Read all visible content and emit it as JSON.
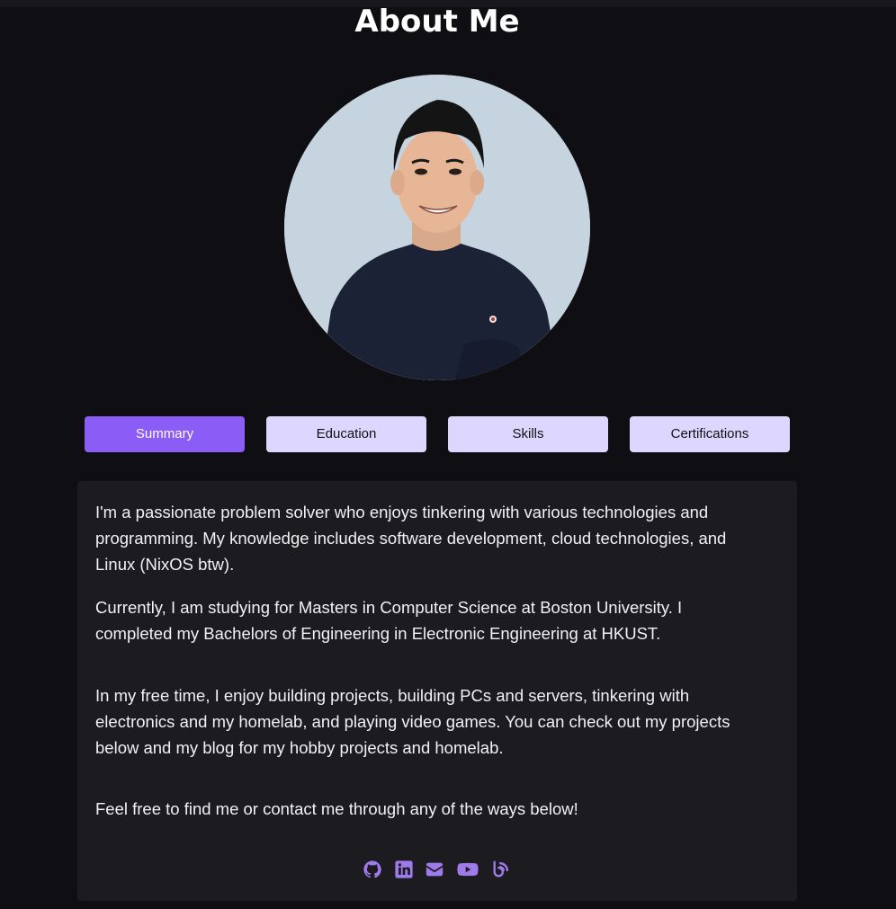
{
  "page": {
    "title": "About Me"
  },
  "tabs": [
    {
      "label": "Summary",
      "active": true
    },
    {
      "label": "Education",
      "active": false
    },
    {
      "label": "Skills",
      "active": false
    },
    {
      "label": "Certifications",
      "active": false
    }
  ],
  "summary": {
    "paragraphs": [
      "I'm a passionate problem solver who enjoys tinkering with various technologies and programming. My knowledge includes software development, cloud technologies, and Linux (NixOS btw).",
      "Currently, I am studying for Masters in Computer Science at Boston University. I completed my Bachelors of Engineering in Electronic Engineering at HKUST.",
      "In my free time, I enjoy building projects, building PCs and servers, tinkering with electronics and my homelab, and playing video games. You can check out my projects below and my blog for my hobby projects and homelab.",
      "Feel free to find me or contact me through any of the ways below!"
    ]
  },
  "socials": [
    {
      "icon": "github-icon"
    },
    {
      "icon": "linkedin-icon"
    },
    {
      "icon": "envelope-icon"
    },
    {
      "icon": "youtube-icon"
    },
    {
      "icon": "blog-icon"
    }
  ],
  "colors": {
    "background": "#0f0f13",
    "card": "#1b1b20",
    "accent": "#8b5cf6",
    "tab_inactive": "#ddd6fe",
    "icon": "#9f7aea"
  }
}
